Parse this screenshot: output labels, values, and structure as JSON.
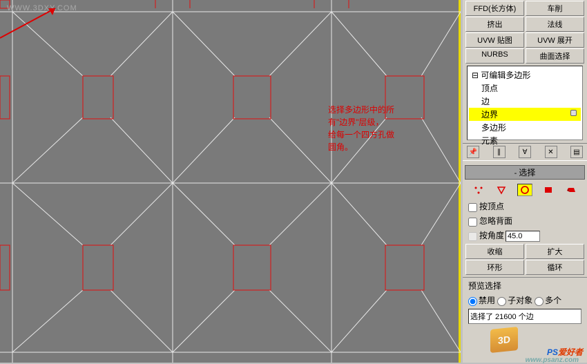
{
  "watermarks": {
    "top_left": "WWW.3DXY.COM",
    "bottom_right_brand": "PS爱好者",
    "bottom_right_url": "www.psanz.com",
    "logo3d": "3D"
  },
  "annotation": {
    "line1": "选择多边形中的所",
    "line2": "有\"边界\"层级，",
    "line3": "给每一个四方孔做",
    "line4": "圆角。"
  },
  "modifiers": {
    "ffd": "FFD(长方体)",
    "lathe": "车削",
    "extrude": "挤出",
    "spline": "法线",
    "uvw_map": "UVW 贴图",
    "uvw_unwrap": "UVW 展开",
    "nurbs": "NURBS",
    "face_sel": "曲面选择"
  },
  "stack": {
    "root": "可编辑多边形",
    "vertex": "顶点",
    "edge": "边",
    "border": "边界",
    "polygon": "多边形",
    "element": "元素"
  },
  "rollouts": {
    "selection_title": "选择"
  },
  "selection": {
    "by_vertex": "按顶点",
    "ignore_backfacing": "忽略背面",
    "by_angle": "按角度",
    "by_angle_value": "45.0",
    "shrink": "收缩",
    "grow": "扩大",
    "ring": "环形",
    "loop": "循环",
    "preview_label": "预览选择",
    "preview_off": "禁用",
    "preview_subobj": "子对象",
    "preview_multi": "多个",
    "info": "选择了 21600 个边"
  },
  "icons": {
    "pin": "pin-icon",
    "show": "show-end-result-icon",
    "make_unique": "make-unique-icon",
    "remove": "remove-modifier-icon",
    "configure": "configure-sets-icon",
    "vertex": "vertex-subobj-icon",
    "edge": "edge-subobj-icon",
    "border": "border-subobj-icon",
    "polygon": "polygon-subobj-icon",
    "element": "element-subobj-icon"
  }
}
